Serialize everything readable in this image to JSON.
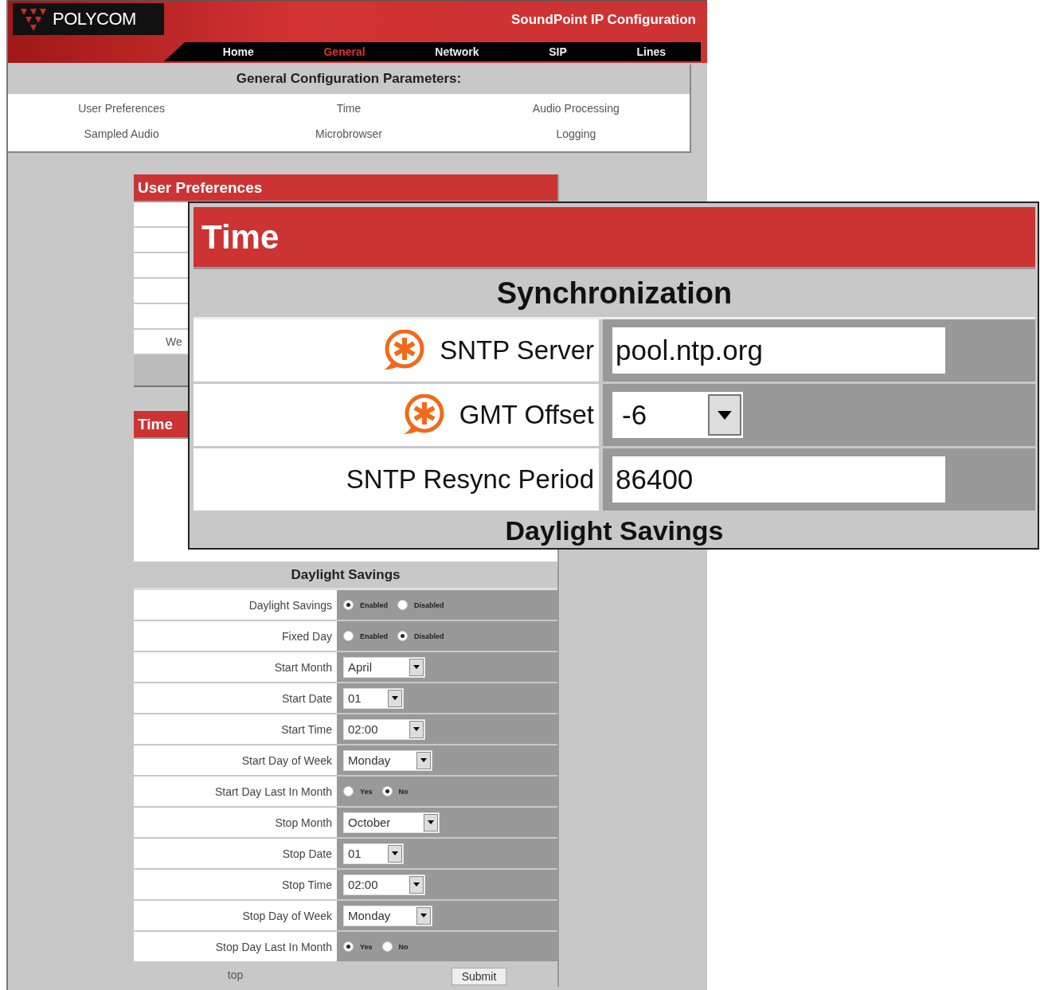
{
  "header": {
    "logo": "POLYCOM",
    "title": "SoundPoint IP Configuration"
  },
  "nav": [
    {
      "label": "Home",
      "selected": false
    },
    {
      "label": "General",
      "selected": true
    },
    {
      "label": "Network",
      "selected": false
    },
    {
      "label": "SIP",
      "selected": false
    },
    {
      "label": "Lines",
      "selected": false
    }
  ],
  "config_panel": {
    "title": "General Configuration Parameters:",
    "links": [
      "User Preferences",
      "Time",
      "Audio Processing",
      "Sampled Audio",
      "Microbrowser",
      "Logging"
    ]
  },
  "user_preferences": {
    "title": "User Preferences",
    "label_fragment": "We"
  },
  "time_section": {
    "title": "Time",
    "daylight_title": "Daylight Savings",
    "rows": [
      {
        "label": "Daylight Savings",
        "kind": "radio",
        "options": [
          {
            "label": "Enabled",
            "selected": true
          },
          {
            "label": "Disabled",
            "selected": false
          }
        ]
      },
      {
        "label": "Fixed Day",
        "kind": "radio",
        "options": [
          {
            "label": "Enabled",
            "selected": false
          },
          {
            "label": "Disabled",
            "selected": true
          }
        ]
      },
      {
        "label": "Start Month",
        "kind": "select",
        "value": "April"
      },
      {
        "label": "Start Date",
        "kind": "select",
        "value": "01"
      },
      {
        "label": "Start Time",
        "kind": "select",
        "value": "02:00"
      },
      {
        "label": "Start Day of Week",
        "kind": "select",
        "value": "Monday"
      },
      {
        "label": "Start Day Last In Month",
        "kind": "radio",
        "options": [
          {
            "label": "Yes",
            "selected": false
          },
          {
            "label": "No",
            "selected": true
          }
        ]
      },
      {
        "label": "Stop Month",
        "kind": "select",
        "value": "October"
      },
      {
        "label": "Stop Date",
        "kind": "select",
        "value": "01"
      },
      {
        "label": "Stop Time",
        "kind": "select",
        "value": "02:00"
      },
      {
        "label": "Stop Day of Week",
        "kind": "select",
        "value": "Monday"
      },
      {
        "label": "Stop Day Last In Month",
        "kind": "radio",
        "options": [
          {
            "label": "Yes",
            "selected": true
          },
          {
            "label": "No",
            "selected": false
          }
        ]
      }
    ],
    "footer": {
      "link": "top",
      "button": "Submit"
    }
  },
  "zoom_callout": {
    "title": "Time",
    "section": "Synchronization",
    "rows": [
      {
        "label": "SNTP Server",
        "required": true,
        "kind": "text",
        "value": "pool.ntp.org"
      },
      {
        "label": "GMT Offset",
        "required": true,
        "kind": "select",
        "value": "-6"
      },
      {
        "label": "SNTP Resync Period",
        "required": false,
        "kind": "text",
        "value": "86400"
      }
    ],
    "next_section": "Daylight Savings"
  }
}
